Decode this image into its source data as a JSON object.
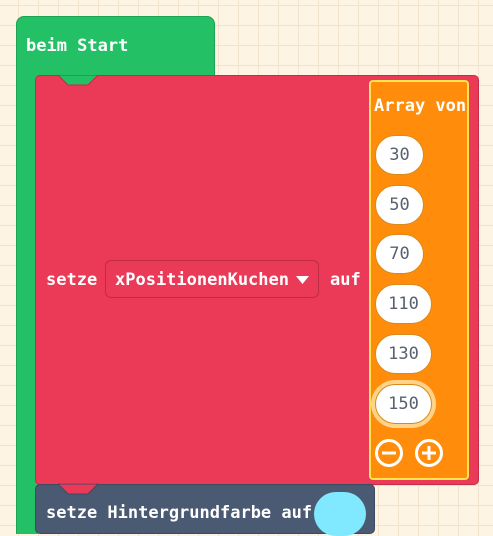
{
  "on_start": {
    "label": "beim Start"
  },
  "set_block": {
    "set_label": "setze",
    "variable": "xPositionenKuchen",
    "to_label": "auf"
  },
  "array_block": {
    "label": "Array von",
    "values": [
      "30",
      "50",
      "70",
      "110",
      "130",
      "150"
    ],
    "selected_index": 5
  },
  "bottom_block": {
    "label": "setze Hintergrundfarbe auf",
    "swatch_color": "#80e8ff"
  },
  "colors": {
    "workspace": "#fdf4e3",
    "start_green": "#23c066",
    "variables_red": "#ea3a58",
    "arrays_orange": "#ff8c0a",
    "highlight_yellow": "#ffe552",
    "scene_slate": "#4a5a73"
  },
  "icons": {
    "dropdown": "caret-down-icon",
    "remove": "minus-circle-icon",
    "add": "plus-circle-icon"
  }
}
